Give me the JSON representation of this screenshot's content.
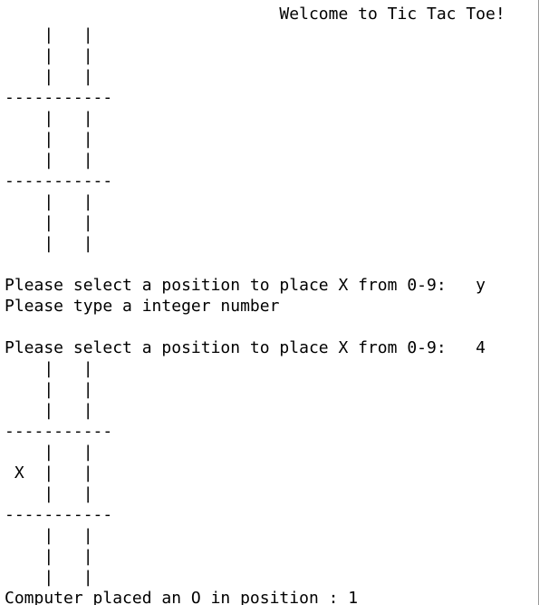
{
  "console": {
    "lines": [
      "                            Welcome to Tic Tac Toe!",
      "    |   |",
      "    |   |",
      "    |   |",
      "-----------",
      "    |   |",
      "    |   |",
      "    |   |",
      "-----------",
      "    |   |",
      "    |   |",
      "    |   |",
      "",
      "Please select a position to place X from 0-9:   y",
      "Please type a integer number",
      "",
      "Please select a position to place X from 0-9:   4",
      "    |   |",
      "    |   |",
      "    |   |",
      "-----------",
      "    |   |",
      " X  |   |",
      "    |   |",
      "-----------",
      "    |   |",
      "    |   |",
      "    |   |",
      "Computer placed an O in position : 1"
    ]
  }
}
